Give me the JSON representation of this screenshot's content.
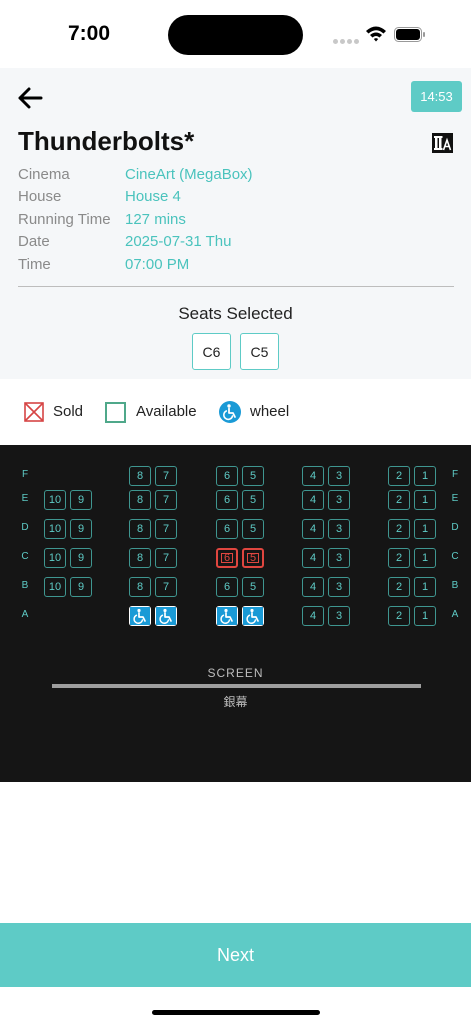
{
  "status_bar": {
    "time": "7:00"
  },
  "header": {
    "clock": "14:53",
    "title": "Thunderbolts*",
    "info": [
      {
        "label": "Cinema",
        "value": "CineArt (MegaBox)"
      },
      {
        "label": "House",
        "value": "House 4"
      },
      {
        "label": "Running Time",
        "value": "127 mins"
      },
      {
        "label": "Date",
        "value": "2025-07-31 Thu"
      },
      {
        "label": "Time",
        "value": "07:00 PM"
      }
    ],
    "seats_selected_label": "Seats Selected",
    "selected_seats": [
      "C6",
      "C5"
    ]
  },
  "legend": {
    "sold": "Sold",
    "available": "Available",
    "wheel": "wheel"
  },
  "seat_map": {
    "rows": [
      "F",
      "E",
      "D",
      "C",
      "B",
      "A"
    ],
    "blocks": [
      {
        "seats": [
          "10",
          "9"
        ],
        "rows": [
          "E",
          "D",
          "C",
          "B"
        ]
      },
      {
        "seats": [
          "8",
          "7"
        ],
        "rows": [
          "F",
          "E",
          "D",
          "C",
          "B",
          "A"
        ]
      },
      {
        "seats": [
          "6",
          "5"
        ],
        "rows": [
          "F",
          "E",
          "D",
          "C",
          "B",
          "A"
        ]
      },
      {
        "seats": [
          "4",
          "3"
        ],
        "rows": [
          "F",
          "E",
          "D",
          "C",
          "B",
          "A"
        ]
      },
      {
        "seats": [
          "2",
          "1"
        ],
        "rows": [
          "F",
          "E",
          "D",
          "C",
          "B",
          "A"
        ]
      }
    ],
    "wheelchair_seats": [
      "A8",
      "A7",
      "A6",
      "A5"
    ],
    "selected": [
      "C6",
      "C5"
    ],
    "screen_label": "SCREEN",
    "screen_label_cn": "銀幕"
  },
  "footer": {
    "next_label": "Next"
  },
  "colors": {
    "accent": "#5ecbc6",
    "selected_seat": "#e0463f",
    "map_background": "#151515",
    "wheel": "#1a9ad6"
  }
}
